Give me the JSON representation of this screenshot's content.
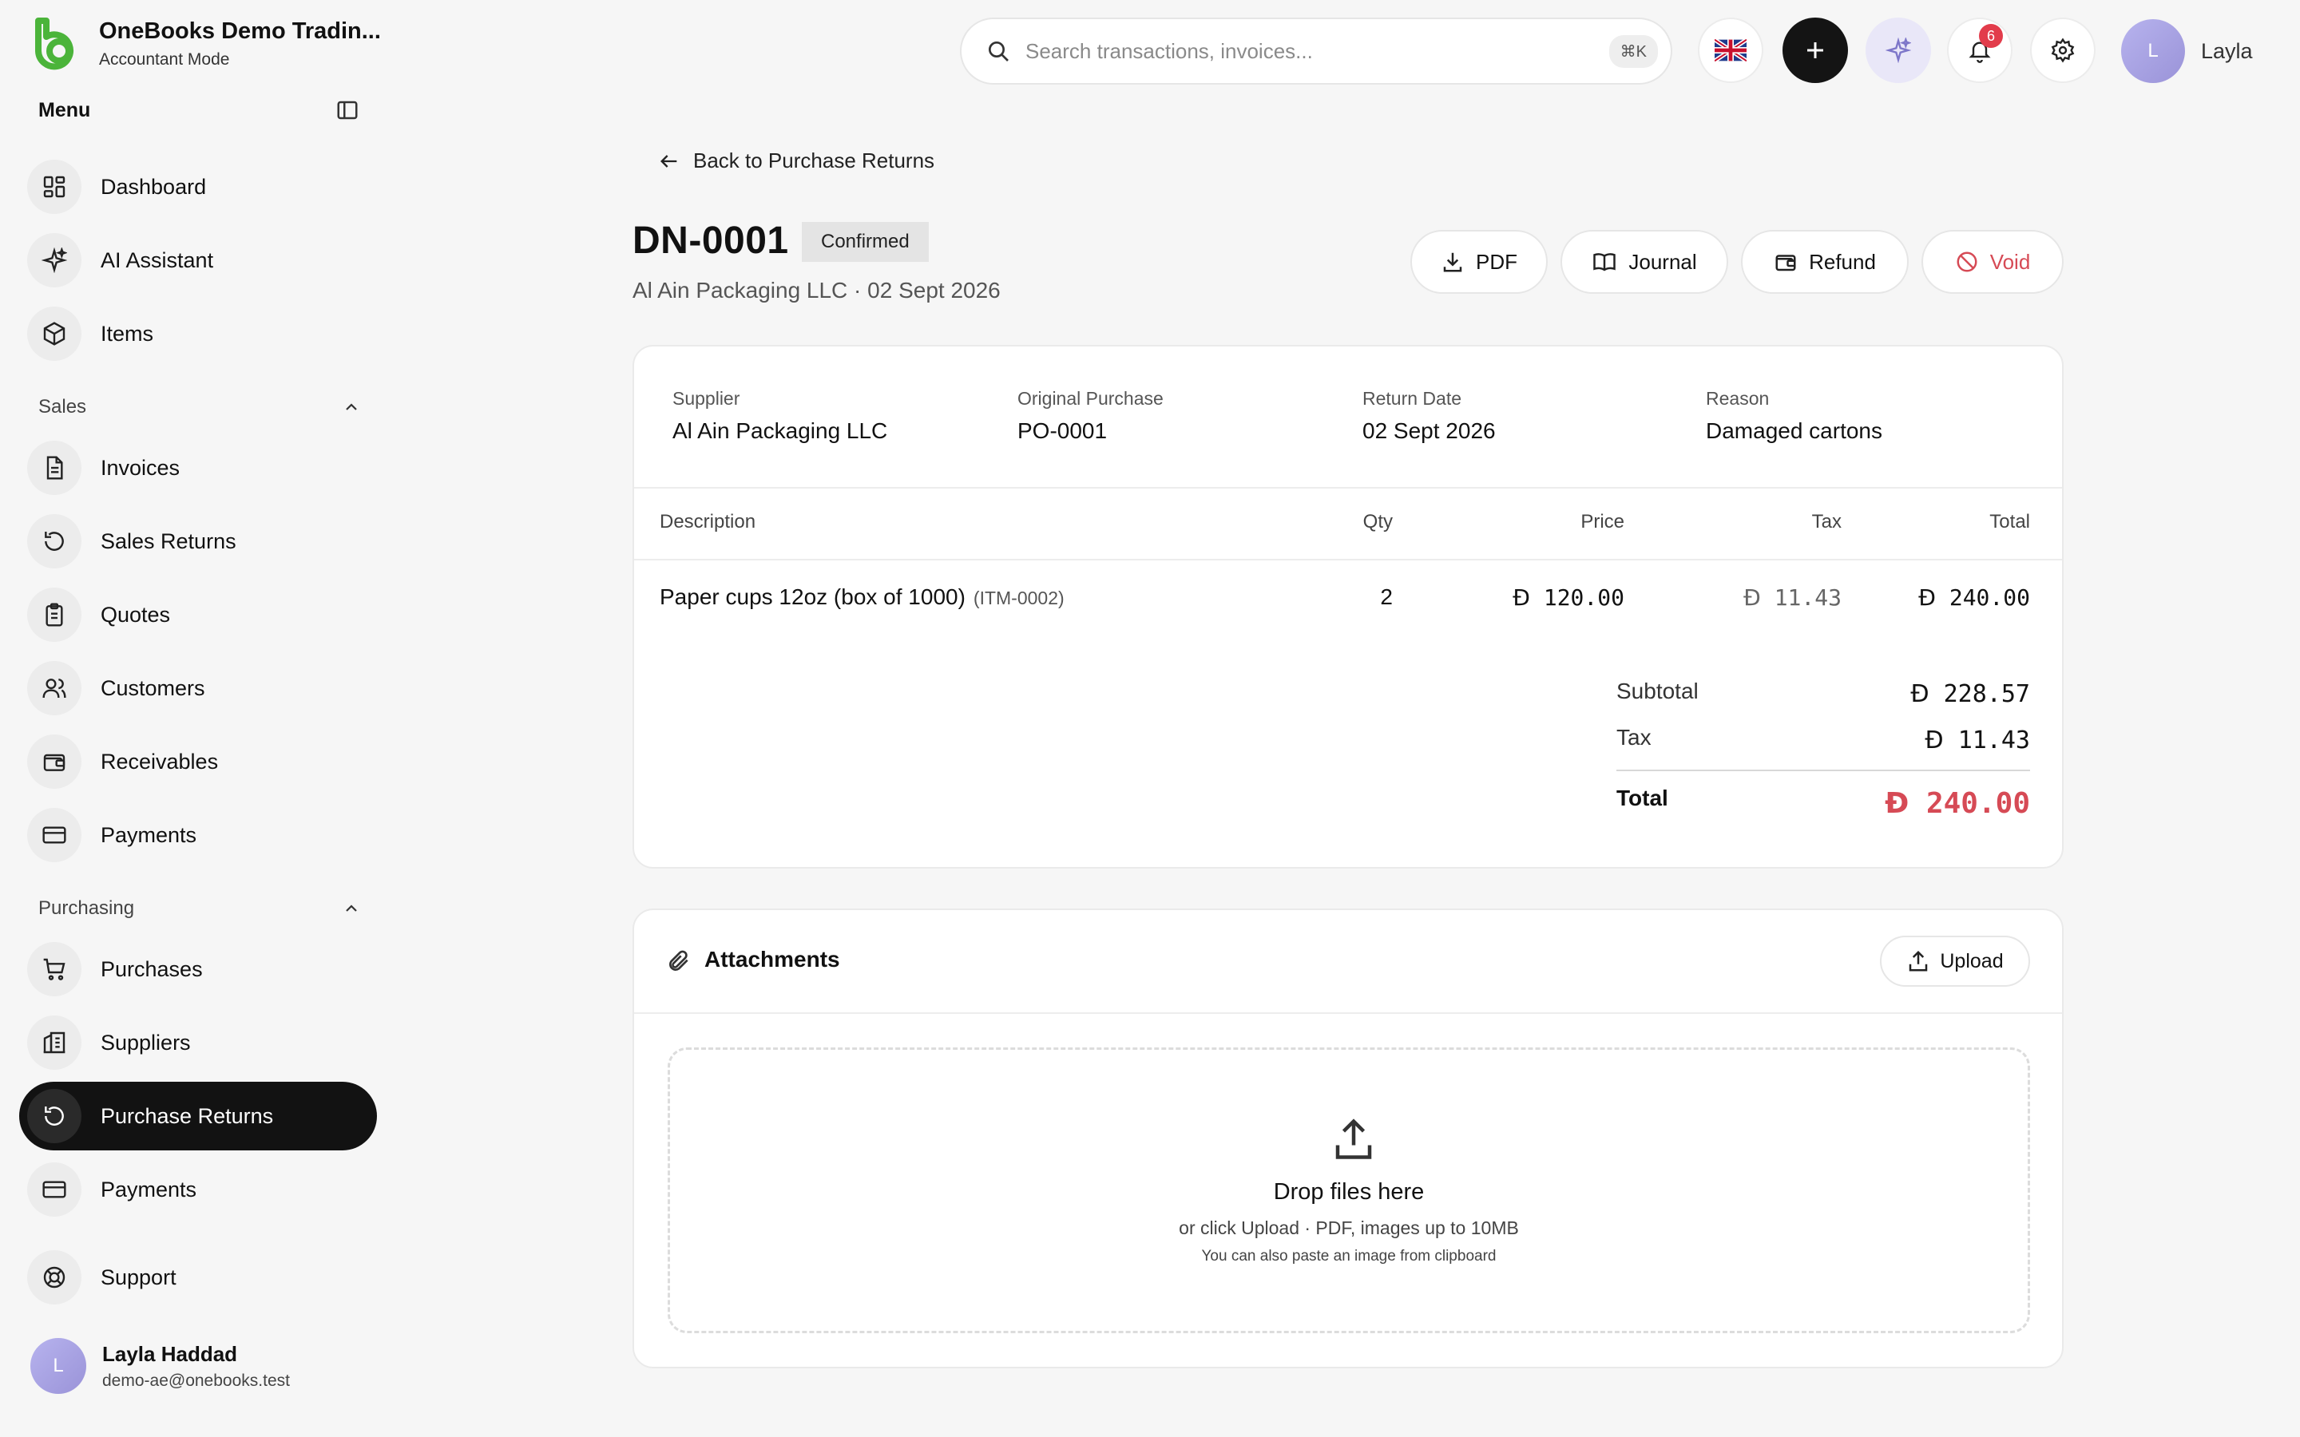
{
  "brand": {
    "name": "OneBooks Demo Tradin...",
    "mode": "Accountant Mode",
    "accent": "#4bb43a"
  },
  "menu": {
    "title": "Menu"
  },
  "nav": {
    "top": [
      {
        "label": "Dashboard",
        "icon": "dashboard-icon"
      },
      {
        "label": "AI Assistant",
        "icon": "sparkles-icon"
      },
      {
        "label": "Items",
        "icon": "box-icon"
      }
    ],
    "sales": {
      "label": "Sales",
      "items": [
        {
          "label": "Invoices",
          "icon": "document-icon"
        },
        {
          "label": "Sales Returns",
          "icon": "return-icon"
        },
        {
          "label": "Quotes",
          "icon": "clipboard-icon"
        },
        {
          "label": "Customers",
          "icon": "users-icon"
        },
        {
          "label": "Receivables",
          "icon": "wallet-icon"
        },
        {
          "label": "Payments",
          "icon": "card-icon"
        }
      ]
    },
    "purchasing": {
      "label": "Purchasing",
      "items": [
        {
          "label": "Purchases",
          "icon": "cart-icon"
        },
        {
          "label": "Suppliers",
          "icon": "building-icon"
        },
        {
          "label": "Purchase Returns",
          "icon": "return-icon",
          "active": true
        },
        {
          "label": "Payments",
          "icon": "card-icon"
        }
      ]
    },
    "support": {
      "label": "Support",
      "icon": "lifebuoy-icon"
    }
  },
  "user": {
    "initial": "L",
    "name": "Layla Haddad",
    "email": "demo-ae@onebooks.test",
    "short_name": "Layla"
  },
  "topbar": {
    "search_placeholder": "Search transactions, invoices...",
    "shortcut": "⌘K",
    "notification_count": "6"
  },
  "page": {
    "back_label": "Back to Purchase Returns",
    "doc_number": "DN-0001",
    "status": "Confirmed",
    "subtitle": "Al Ain Packaging LLC · 02 Sept 2026",
    "actions": {
      "pdf": "PDF",
      "journal": "Journal",
      "refund": "Refund",
      "void": "Void"
    },
    "meta": {
      "supplier_label": "Supplier",
      "supplier": "Al Ain Packaging LLC",
      "original_label": "Original Purchase",
      "original": "PO-0001",
      "date_label": "Return Date",
      "date": "02 Sept 2026",
      "reason_label": "Reason",
      "reason": "Damaged cartons"
    },
    "table": {
      "headers": {
        "description": "Description",
        "qty": "Qty",
        "price": "Price",
        "tax": "Tax",
        "total": "Total"
      },
      "rows": [
        {
          "description": "Paper cups 12oz (box of 1000)",
          "code": "(ITM-0002)",
          "qty": "2",
          "price": "120.00",
          "tax": "11.43",
          "total": "240.00"
        }
      ]
    },
    "currency_symbol": "Đ",
    "totals": {
      "subtotal_label": "Subtotal",
      "subtotal": "228.57",
      "tax_label": "Tax",
      "tax": "11.43",
      "total_label": "Total",
      "total": "240.00"
    },
    "attachments": {
      "title": "Attachments",
      "upload_label": "Upload",
      "drop_title": "Drop files here",
      "drop_sub": "or click Upload · PDF, images up to 10MB",
      "drop_note": "You can also paste an image from clipboard"
    }
  }
}
